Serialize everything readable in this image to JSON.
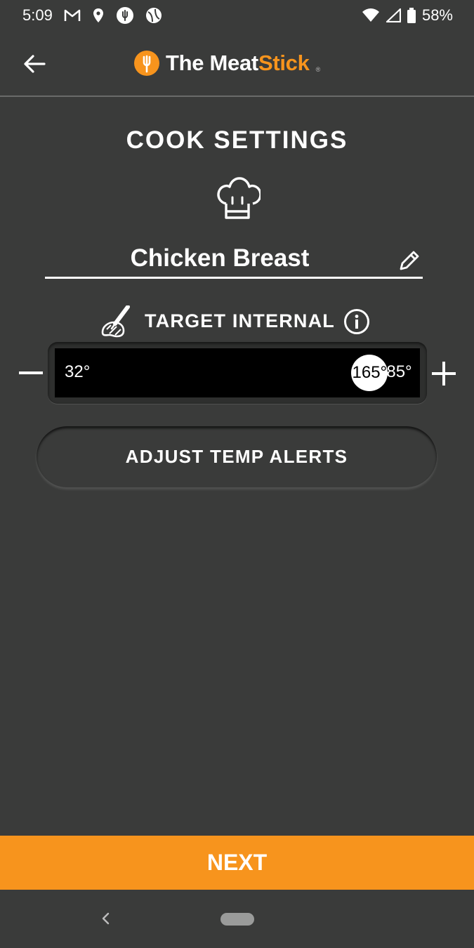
{
  "status_bar": {
    "time": "5:09",
    "left_icons": [
      "gmail-icon",
      "location-icon",
      "meatstick-notification-icon",
      "sports-icon"
    ],
    "right_icons": [
      "wifi-icon",
      "signal-icon",
      "battery-icon"
    ],
    "battery": "58%"
  },
  "header": {
    "logo_prefix": "The Meat",
    "logo_accent": "Stick",
    "logo_reg": "®",
    "brand_color": "#f7941d"
  },
  "main": {
    "title": "COOK SETTINGS",
    "cook_name": "Chicken Breast",
    "target_label": "TARGET INTERNAL",
    "slider": {
      "min_label": "32°",
      "max_label": "185°",
      "value_label": "165°",
      "min": 32,
      "max": 185,
      "value": 165
    },
    "alerts_button_label": "ADJUST TEMP ALERTS"
  },
  "footer": {
    "next_label": "NEXT"
  }
}
